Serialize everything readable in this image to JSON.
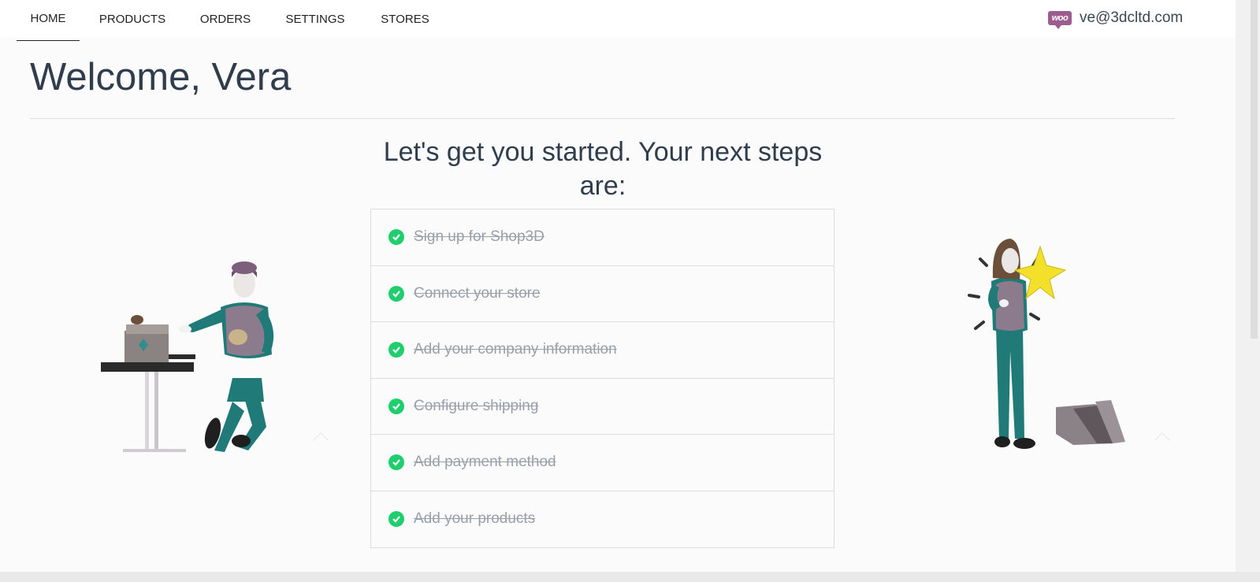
{
  "nav": {
    "items": [
      {
        "label": "HOME",
        "active": true
      },
      {
        "label": "PRODUCTS",
        "active": false
      },
      {
        "label": "ORDERS",
        "active": false
      },
      {
        "label": "SETTINGS",
        "active": false
      },
      {
        "label": "STORES",
        "active": false
      }
    ],
    "brand_badge": "woo",
    "user_email": "ve@3dcltd.com"
  },
  "main": {
    "welcome": "Welcome, Vera",
    "steps_heading": "Let's get you started. Your next steps are:",
    "steps": [
      {
        "label": "Sign up for Shop3D",
        "done": true
      },
      {
        "label": "Connect your store",
        "done": true
      },
      {
        "label": "Add your company information",
        "done": true
      },
      {
        "label": "Configure shipping",
        "done": true
      },
      {
        "label": "Add payment method",
        "done": true
      },
      {
        "label": "Add your products",
        "done": true
      }
    ]
  },
  "colors": {
    "check": "#1fcf6e",
    "heading": "#2f3d4d",
    "done_text": "#9aa0a8",
    "woo_brand": "#9b5c8f",
    "figure_teal": "#1f7a78",
    "figure_vest": "#8c7b8c",
    "star": "#f2e02a"
  },
  "icons": {
    "check": "check-circle-icon",
    "brand": "woo-logo-icon"
  }
}
